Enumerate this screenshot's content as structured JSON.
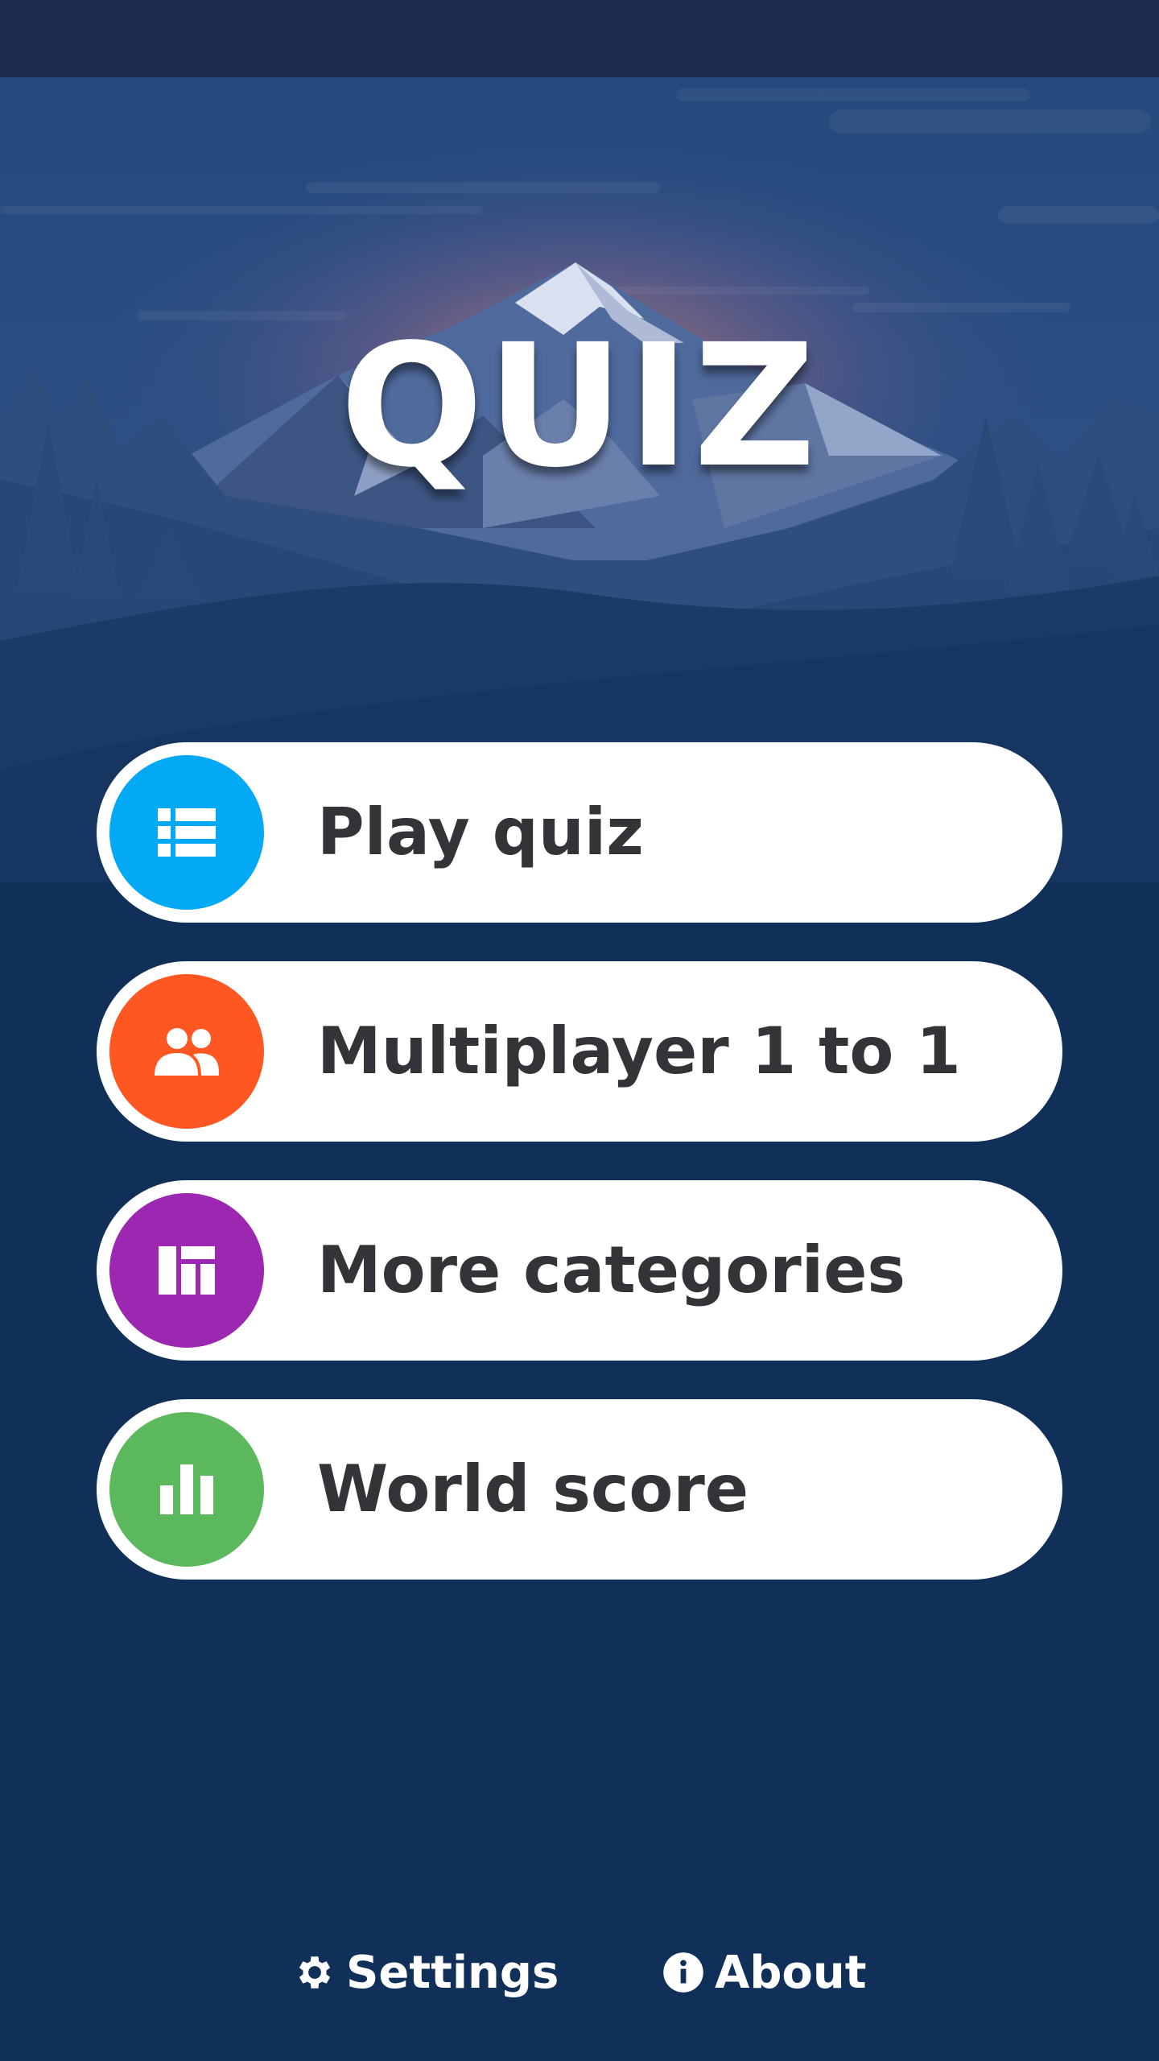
{
  "app": {
    "title": "QUIZ"
  },
  "menu": [
    {
      "label": "Play quiz",
      "icon": "list-icon",
      "color": "#03a9f4"
    },
    {
      "label": "Multiplayer 1 to 1",
      "icon": "people-icon",
      "color": "#ff5722"
    },
    {
      "label": "More categories",
      "icon": "dashboard-icon",
      "color": "#9c27b0"
    },
    {
      "label": "World score",
      "icon": "bar-chart-icon",
      "color": "#5cb85c"
    }
  ],
  "footer": {
    "settings_label": "Settings",
    "about_label": "About"
  }
}
